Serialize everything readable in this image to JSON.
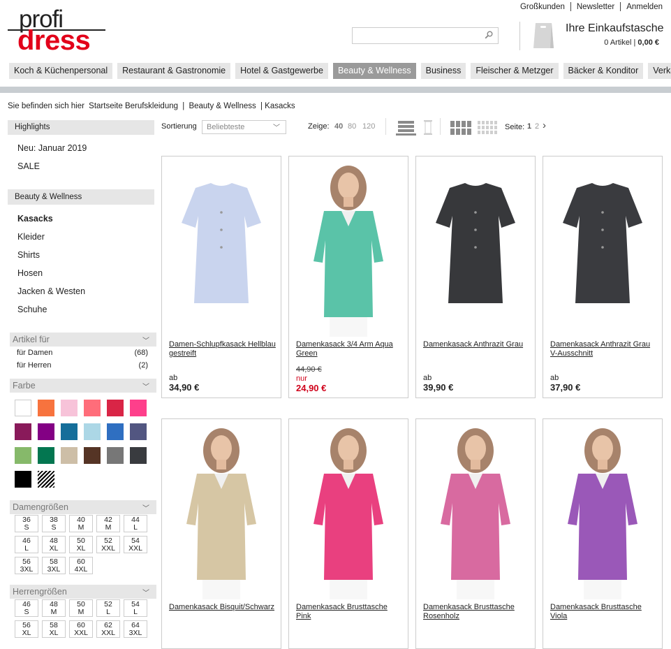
{
  "brand": {
    "line1": "profi",
    "line2": "dress"
  },
  "top_links": [
    "Großkunden",
    "Newsletter",
    "Anmelden"
  ],
  "search": {
    "placeholder": "",
    "value": ""
  },
  "cart": {
    "title": "Ihre Einkaufstasche",
    "count_label": "0 Artikel",
    "total": "0,00 €"
  },
  "nav": [
    {
      "label": "Koch & Küchenpersonal",
      "active": false
    },
    {
      "label": "Restaurant & Gastronomie",
      "active": false
    },
    {
      "label": "Hotel & Gastgewerbe",
      "active": false
    },
    {
      "label": "Beauty & Wellness",
      "active": true
    },
    {
      "label": "Business",
      "active": false
    },
    {
      "label": "Fleischer & Metzger",
      "active": false
    },
    {
      "label": "Bäcker & Konditor",
      "active": false
    },
    {
      "label": "Verkauf",
      "active": false
    }
  ],
  "breadcrumb": {
    "prefix": "Sie befinden sich hier",
    "items": [
      "Startseite Berufskleidung",
      "Beauty & Wellness"
    ],
    "current": "Kasacks",
    "sep": "|"
  },
  "sidebar": {
    "highlights_title": "Highlights",
    "highlights": [
      "Neu: Januar 2019",
      "SALE"
    ],
    "category_title": "Beauty & Wellness",
    "categories": [
      {
        "label": "Kasacks",
        "active": true
      },
      {
        "label": "Kleider",
        "active": false
      },
      {
        "label": "Shirts",
        "active": false
      },
      {
        "label": "Hosen",
        "active": false
      },
      {
        "label": "Jacken & Westen",
        "active": false
      },
      {
        "label": "Schuhe",
        "active": false
      }
    ],
    "filters": {
      "artikel_title": "Artikel für",
      "artikel": [
        {
          "label": "für Damen",
          "count": "(68)"
        },
        {
          "label": "für Herren",
          "count": "(2)"
        }
      ],
      "farbe_title": "Farbe",
      "colors": [
        "#ffffff",
        "#f7733e",
        "#f7c3d9",
        "#ff6d7a",
        "#d92546",
        "#fe3f8b",
        "#891a5a",
        "#830084",
        "#156e9a",
        "#acd7e6",
        "#2f6fc1",
        "#525681",
        "#86b96a",
        "#037650",
        "#cdbea7",
        "#553425",
        "#777777",
        "#393b3f",
        "#000000",
        "striped"
      ],
      "damen_title": "Damengrößen",
      "damen_sizes": [
        [
          "36",
          "S"
        ],
        [
          "38",
          "S"
        ],
        [
          "40",
          "M"
        ],
        [
          "42",
          "M"
        ],
        [
          "44",
          "L"
        ],
        [
          "46",
          "L"
        ],
        [
          "48",
          "XL"
        ],
        [
          "50",
          "XL"
        ],
        [
          "52",
          "XXL"
        ],
        [
          "54",
          "XXL"
        ],
        [
          "56",
          "3XL"
        ],
        [
          "58",
          "3XL"
        ],
        [
          "60",
          "4XL"
        ]
      ],
      "herren_title": "Herrengrößen",
      "herren_sizes": [
        [
          "46",
          "S"
        ],
        [
          "48",
          "M"
        ],
        [
          "50",
          "M"
        ],
        [
          "52",
          "L"
        ],
        [
          "54",
          "L"
        ],
        [
          "56",
          "XL"
        ],
        [
          "58",
          "XL"
        ],
        [
          "60",
          "XXL"
        ],
        [
          "62",
          "XXL"
        ],
        [
          "64",
          "3XL"
        ]
      ]
    }
  },
  "toolbar": {
    "sort_label": "Sortierung",
    "sort_value": "Beliebteste",
    "show_label": "Zeige:",
    "show_options": [
      "40",
      "80",
      "120"
    ],
    "page_label": "Seite:",
    "pages": [
      "1",
      "2"
    ],
    "next": "›"
  },
  "products": [
    {
      "name": "Damen-Schlupfkasack Hellblau gestreift",
      "from": "ab",
      "price": "34,90 €",
      "garment": "#c9d4ee",
      "model": false
    },
    {
      "name": "Damenkasack 3/4 Arm Aqua Green",
      "old_price": "44,90 €",
      "sale_label": "nur",
      "price": "24,90 €",
      "garment": "#5ac3a8",
      "model": true
    },
    {
      "name": "Damenkasack Anthrazit Grau",
      "from": "ab",
      "price": "39,90 €",
      "garment": "#37383b",
      "model": false
    },
    {
      "name": "Damenkasack Anthrazit Grau V-Ausschnitt",
      "from": "ab",
      "price": "37,90 €",
      "garment": "#3a3b3f",
      "model": false
    },
    {
      "name": "Damenkasack Bisquit/Schwarz",
      "garment": "#d6c6a4",
      "model": true
    },
    {
      "name": "Damenkasack Brusttasche Pink",
      "garment": "#e9407f",
      "model": true
    },
    {
      "name": "Damenkasack Brusttasche Rosenholz",
      "garment": "#d86aa0",
      "model": true
    },
    {
      "name": "Damenkasack Brusttasche Viola",
      "garment": "#9a58b8",
      "model": true
    }
  ]
}
